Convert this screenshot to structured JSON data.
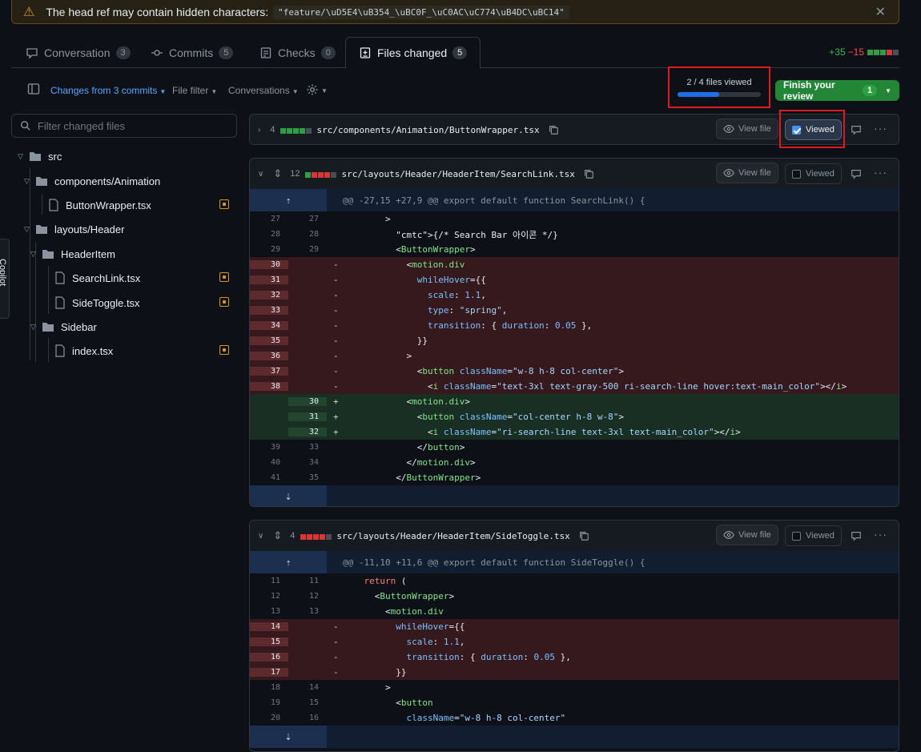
{
  "banner": {
    "message": "The head ref may contain hidden characters:",
    "ref": "\"feature/\\uD5E4\\uB354_\\uBC0F_\\uC0AC\\uC774\\uB4DC\\uBC14\""
  },
  "tabs": [
    {
      "label": "Conversation",
      "count": "3"
    },
    {
      "label": "Commits",
      "count": "5"
    },
    {
      "label": "Checks",
      "count": "0"
    },
    {
      "label": "Files changed",
      "count": "5"
    }
  ],
  "diffstat": {
    "additions": "+35",
    "deletions": "−15"
  },
  "toolbar": {
    "changes_from": "Changes from 3 commits",
    "file_filter": "File filter",
    "conversations": "Conversations"
  },
  "progress": {
    "label": "2 / 4 files viewed",
    "viewed": 2,
    "total": 4
  },
  "finish_review": {
    "label": "Finish your review",
    "count": "1"
  },
  "filter": {
    "placeholder": "Filter changed files"
  },
  "tree": {
    "src": "src",
    "components_animation": "components/Animation",
    "button_wrapper": "ButtonWrapper.tsx",
    "layouts_header": "layouts/Header",
    "header_item": "HeaderItem",
    "search_link": "SearchLink.tsx",
    "side_toggle": "SideToggle.tsx",
    "sidebar": "Sidebar",
    "index": "index.tsx"
  },
  "sidetab": {
    "label": "Copilot"
  },
  "files": [
    {
      "count": "4",
      "path": "src/components/Animation/ButtonWrapper.tsx",
      "view_file": "View file",
      "viewed": "Viewed"
    },
    {
      "count": "12",
      "path": "src/layouts/Header/HeaderItem/SearchLink.tsx",
      "view_file": "View file",
      "viewed": "Viewed",
      "hunk": "@@ -27,15 +27,9 @@ export default function SearchLink() {"
    },
    {
      "count": "4",
      "path": "src/layouts/Header/HeaderItem/SideToggle.tsx",
      "view_file": "View file",
      "viewed": "Viewed",
      "hunk": "@@ -11,10 +11,6 @@ export default function SideToggle() {"
    }
  ],
  "diff1": [
    {
      "t": "ctx",
      "o": "27",
      "n": "27",
      "c": "        >"
    },
    {
      "t": "ctx",
      "o": "28",
      "n": "28",
      "c": "          {/* Search Bar 아이콘 */}"
    },
    {
      "t": "ctx",
      "o": "29",
      "n": "29",
      "c": "          <ButtonWrapper>"
    },
    {
      "t": "del",
      "o": "30",
      "n": "",
      "c": "            <motion.div"
    },
    {
      "t": "del",
      "o": "31",
      "n": "",
      "c": "              whileHover={{"
    },
    {
      "t": "del",
      "o": "32",
      "n": "",
      "c": "                scale: 1.1,"
    },
    {
      "t": "del",
      "o": "33",
      "n": "",
      "c": "                type: \"spring\","
    },
    {
      "t": "del",
      "o": "34",
      "n": "",
      "c": "                transition: { duration: 0.05 },"
    },
    {
      "t": "del",
      "o": "35",
      "n": "",
      "c": "              }}"
    },
    {
      "t": "del",
      "o": "36",
      "n": "",
      "c": "            >"
    },
    {
      "t": "del",
      "o": "37",
      "n": "",
      "c": "              <button className=\"w-8 h-8 col-center\">"
    },
    {
      "t": "del",
      "o": "38",
      "n": "",
      "c": "                <i className=\"text-3xl text-gray-500 ri-search-line hover:text-main_color\"></i>"
    },
    {
      "t": "add",
      "o": "",
      "n": "30",
      "c": "            <motion.div>"
    },
    {
      "t": "add",
      "o": "",
      "n": "31",
      "c": "              <button className=\"col-center h-8 w-8\">"
    },
    {
      "t": "add",
      "o": "",
      "n": "32",
      "c": "                <i className=\"ri-search-line text-3xl text-main_color\"></i>"
    },
    {
      "t": "ctx",
      "o": "39",
      "n": "33",
      "c": "              </button>"
    },
    {
      "t": "ctx",
      "o": "40",
      "n": "34",
      "c": "            </motion.div>"
    },
    {
      "t": "ctx",
      "o": "41",
      "n": "35",
      "c": "          </ButtonWrapper>"
    }
  ],
  "diff2": [
    {
      "t": "ctx",
      "o": "11",
      "n": "11",
      "c": "    return ("
    },
    {
      "t": "ctx",
      "o": "12",
      "n": "12",
      "c": "      <ButtonWrapper>"
    },
    {
      "t": "ctx",
      "o": "13",
      "n": "13",
      "c": "        <motion.div"
    },
    {
      "t": "del",
      "o": "14",
      "n": "",
      "c": "          whileHover={{"
    },
    {
      "t": "del",
      "o": "15",
      "n": "",
      "c": "            scale: 1.1,"
    },
    {
      "t": "del",
      "o": "16",
      "n": "",
      "c": "            transition: { duration: 0.05 },"
    },
    {
      "t": "del",
      "o": "17",
      "n": "",
      "c": "          }}"
    },
    {
      "t": "ctx",
      "o": "18",
      "n": "14",
      "c": "        >"
    },
    {
      "t": "ctx",
      "o": "19",
      "n": "15",
      "c": "          <button"
    },
    {
      "t": "ctx",
      "o": "20",
      "n": "16",
      "c": "            className=\"w-8 h-8 col-center\""
    }
  ],
  "colors": {
    "accent": "#1f6feb",
    "add": "#2ea043",
    "del": "#da3633",
    "highlight": "#e0191f"
  }
}
